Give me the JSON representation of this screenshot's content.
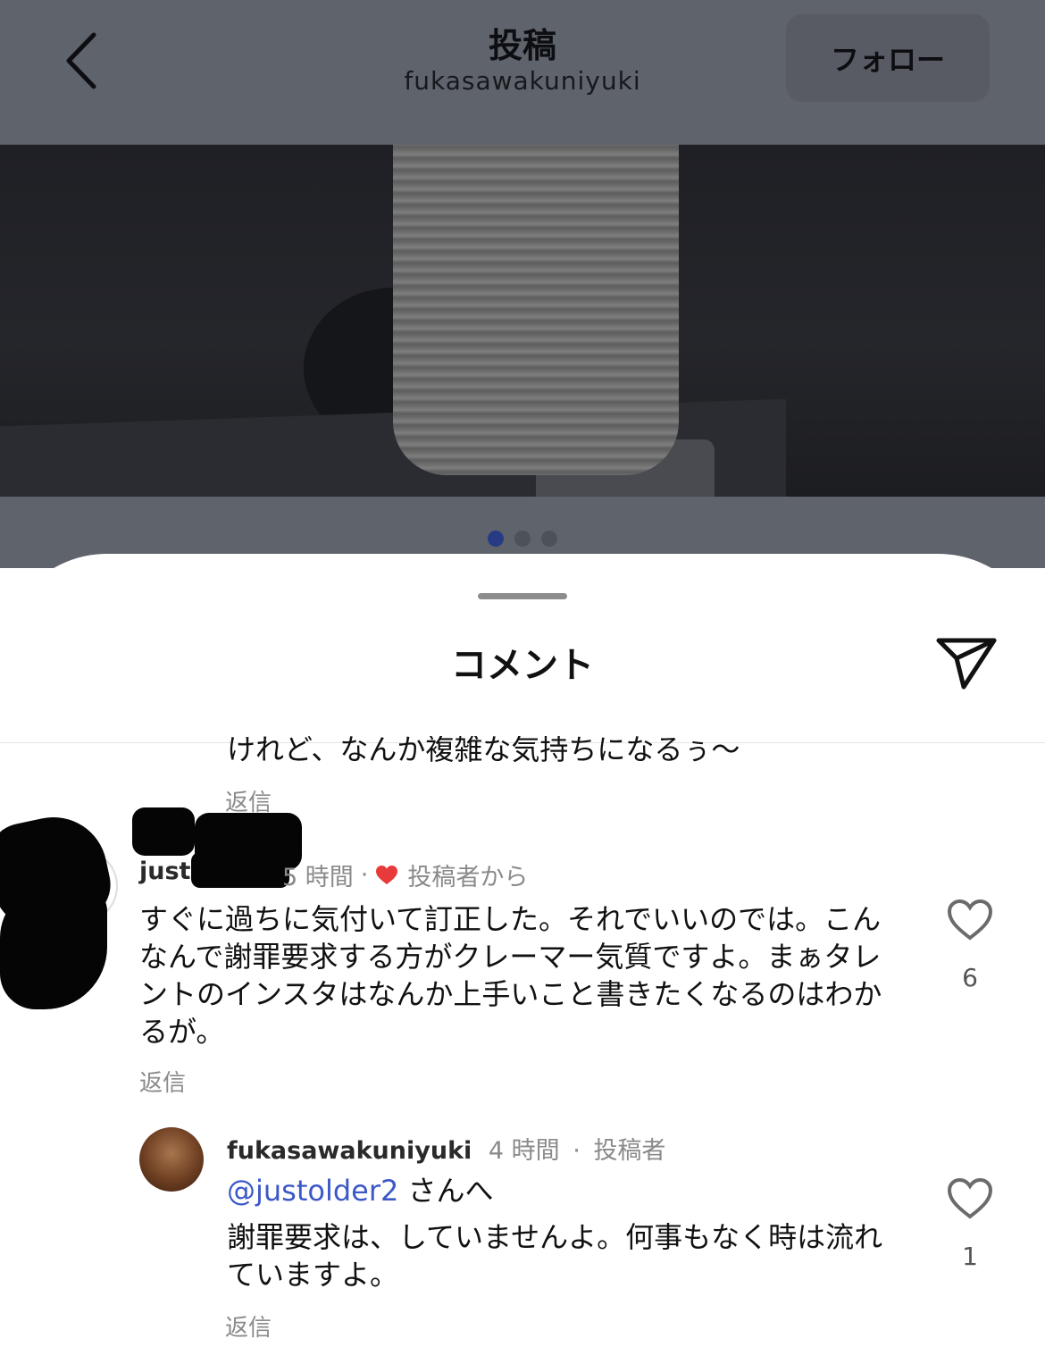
{
  "header": {
    "title": "投稿",
    "username": "fukasawakuniyuki",
    "follow_label": "フォロー"
  },
  "carousel": {
    "count": 3,
    "active_index": 0
  },
  "sheet": {
    "title": "コメント"
  },
  "comments": [
    {
      "text_fragment": "けれど、なんか複雑な気持ちになるぅ〜",
      "reply_label": "返信"
    },
    {
      "username_visible": "justo",
      "time_visible": "5 時間",
      "liked_by_author_label": "投稿者から",
      "text": "すぐに過ちに気付いて訂正した。それでいいのでは。こんなんで謝罪要求する方がクレーマー気質ですよ。まぁタレントのインスタはなんか上手いこと書きたくなるのはわかるが。",
      "likes": "6",
      "reply_label": "返信"
    },
    {
      "username": "fukasawakuniyuki",
      "time": "4 時間",
      "author_badge": "投稿者",
      "mention": "@justolder2",
      "mention_suffix": " さんへ",
      "text": "謝罪要求は、していませんよ。何事もなく時は流れていますよ。",
      "likes": "1",
      "reply_label": "返信"
    }
  ]
}
